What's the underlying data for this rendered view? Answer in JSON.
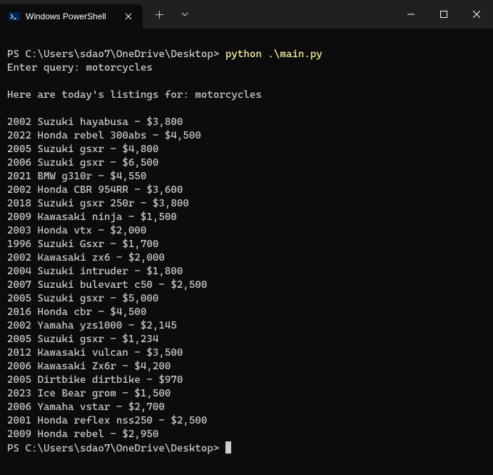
{
  "window": {
    "tab_title": "Windows PowerShell"
  },
  "terminal": {
    "prompt1": "PS C:\\Users\\sdao7\\OneDrive\\Desktop> ",
    "command1": "python .\\main.py",
    "query_prompt": "Enter query: ",
    "query_value": "motorcycles",
    "result_header": "Here are today's listings for: motorcycles",
    "listings": [
      "2002 Suzuki hayabusa - $3,800",
      "2022 Honda rebel 300abs - $4,500",
      "2005 Suzuki gsxr - $4,800",
      "2006 Suzuki gsxr - $6,500",
      "2021 BMW g310r - $4,550",
      "2002 Honda CBR 954RR - $3,600",
      "2018 Suzuki gsxr 250r - $3,800",
      "2009 Kawasaki ninja - $1,500",
      "2003 Honda vtx - $2,000",
      "1996 Suzuki Gsxr - $1,700",
      "2002 Kawasaki zx6 - $2,000",
      "2004 Suzuki intruder - $1,800",
      "2007 Suzuki bulevart c50 - $2,500",
      "2005 Suzuki gsxr - $5,000",
      "2016 Honda cbr - $4,500",
      "2002 Yamaha yzs1000 - $2,145",
      "2005 Suzuki gsxr - $1,234",
      "2012 Kawasaki vulcan - $3,500",
      "2006 Kawasaki Zx6r - $4,200",
      "2005 Dirtbike dirtbike - $970",
      "2023 Ice Bear grom - $1,500",
      "2006 Yamaha vstar - $2,700",
      "2001 Honda reflex nss250 - $2,500",
      "2009 Honda rebel - $2,950"
    ],
    "prompt2": "PS C:\\Users\\sdao7\\OneDrive\\Desktop> "
  }
}
